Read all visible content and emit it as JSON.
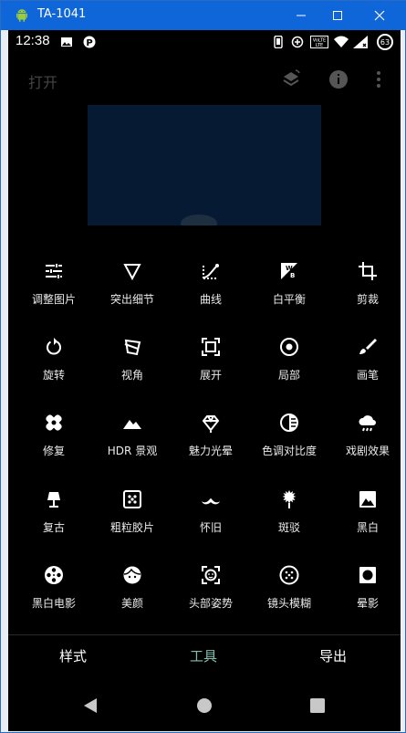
{
  "window": {
    "title": "TA-1041",
    "accent": "#0f66d8",
    "controls": [
      "minimize-icon",
      "maximize-icon",
      "close-icon"
    ]
  },
  "statusbar": {
    "time": "12:38",
    "battery": "63",
    "left_icons": [
      "image-icon",
      "p-app-icon"
    ],
    "right_icons": [
      "vibrate-icon",
      "data-saver-icon",
      "volte-icon",
      "wifi-icon",
      "signal-icon",
      "battery-icon"
    ]
  },
  "appbar": {
    "open_label": "打开",
    "icons": [
      "layers-refresh-icon",
      "info-icon",
      "more-vert-icon"
    ]
  },
  "tools": [
    {
      "label": "调整图片",
      "icon": "tune-icon"
    },
    {
      "label": "突出细节",
      "icon": "triangle-details-icon"
    },
    {
      "label": "曲线",
      "icon": "curves-icon"
    },
    {
      "label": "白平衡",
      "icon": "white-balance-icon"
    },
    {
      "label": "剪裁",
      "icon": "crop-icon"
    },
    {
      "label": "旋转",
      "icon": "rotate-icon"
    },
    {
      "label": "视角",
      "icon": "perspective-icon"
    },
    {
      "label": "展开",
      "icon": "expand-icon"
    },
    {
      "label": "局部",
      "icon": "selective-icon"
    },
    {
      "label": "画笔",
      "icon": "brush-icon"
    },
    {
      "label": "修复",
      "icon": "healing-icon"
    },
    {
      "label": "HDR 景观",
      "icon": "hdr-landscape-icon"
    },
    {
      "label": "魅力光晕",
      "icon": "glamour-glow-icon"
    },
    {
      "label": "色调对比度",
      "icon": "tonal-contrast-icon"
    },
    {
      "label": "戏剧效果",
      "icon": "drama-icon"
    },
    {
      "label": "复古",
      "icon": "vintage-lamp-icon"
    },
    {
      "label": "粗粒胶片",
      "icon": "grainy-film-icon"
    },
    {
      "label": "怀旧",
      "icon": "mustache-icon"
    },
    {
      "label": "斑驳",
      "icon": "grunge-icon"
    },
    {
      "label": "黑白",
      "icon": "black-white-icon"
    },
    {
      "label": "黑白电影",
      "icon": "film-reel-icon"
    },
    {
      "label": "美颜",
      "icon": "face-icon"
    },
    {
      "label": "头部姿势",
      "icon": "head-pose-icon"
    },
    {
      "label": "镜头模糊",
      "icon": "lens-blur-icon"
    },
    {
      "label": "晕影",
      "icon": "vignette-icon"
    }
  ],
  "bottom_tabs": [
    {
      "label": "样式",
      "active": false
    },
    {
      "label": "工具",
      "active": true
    },
    {
      "label": "导出",
      "active": false
    }
  ],
  "colors": {
    "active_tab": "#7fbfae",
    "tool_label": "#eaeaea"
  },
  "navbar": [
    "back-icon",
    "home-icon",
    "recents-icon"
  ]
}
